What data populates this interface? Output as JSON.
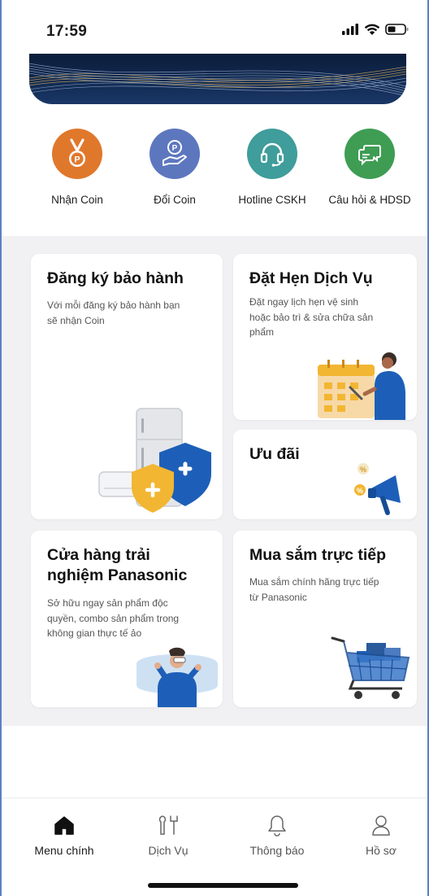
{
  "status": {
    "time": "17:59"
  },
  "quick_actions": [
    {
      "label": "Nhận Coin",
      "icon": "medal-coin-icon",
      "color": "#e0782c"
    },
    {
      "label": "Đổi Coin",
      "icon": "hand-coin-icon",
      "color": "#5d77bf"
    },
    {
      "label": "Hotline CSKH",
      "icon": "headset-icon",
      "color": "#3f9d9b"
    },
    {
      "label": "Câu hỏi & HDSD",
      "icon": "chat-bubbles-icon",
      "color": "#3e9d53"
    }
  ],
  "cards": {
    "warranty": {
      "title": "Đăng ký bảo hành",
      "desc": [
        "Với mỗi đăng ký bảo hành bạn",
        "sẽ nhận Coin"
      ]
    },
    "service": {
      "title": "Đặt Hẹn Dịch Vụ",
      "desc": [
        "Đặt ngay lịch hẹn vệ sinh",
        "hoặc bảo trì & sửa chữa sản",
        "phẩm"
      ]
    },
    "offers": {
      "title": "Ưu đãi"
    },
    "store": {
      "title": [
        "Cửa hàng trải",
        "nghiệm Panasonic"
      ],
      "desc": [
        "Sở hữu ngay sản phẩm độc",
        "quyền, combo sản phẩm trong",
        "không gian thực tế ảo"
      ]
    },
    "shopping": {
      "title": "Mua sắm trực tiếp",
      "desc": [
        "Mua sắm chính hãng trực tiếp",
        "từ Panasonic"
      ]
    }
  },
  "bottom_nav": [
    {
      "label": "Menu chính",
      "icon": "home-icon",
      "active": true
    },
    {
      "label": "Dịch Vụ",
      "icon": "tools-icon",
      "active": false
    },
    {
      "label": "Thông báo",
      "icon": "bell-icon",
      "active": false
    },
    {
      "label": "Hồ sơ",
      "icon": "profile-icon",
      "active": false
    }
  ],
  "colors": {
    "accent_blue": "#1d5fb8",
    "content_bg": "#f1f1f3",
    "banner": "#0c1d3a"
  }
}
